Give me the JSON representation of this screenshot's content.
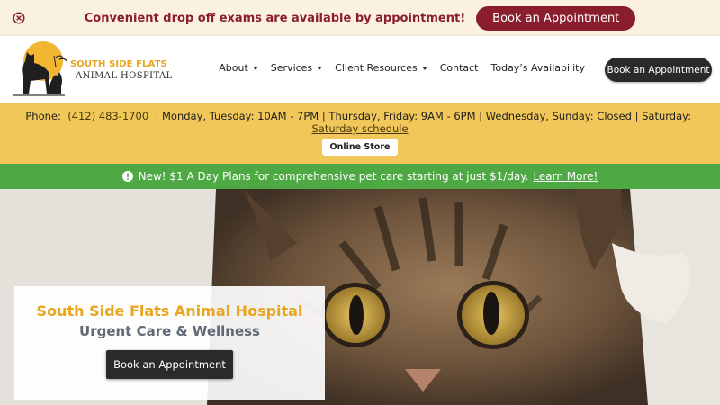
{
  "promo_bar": {
    "close_icon": "close-circle-icon",
    "message": "Convenient drop off exams are available by appointment!",
    "button_label": "Book an Appointment",
    "colors": {
      "background": "#fbf1e3",
      "accent": "#8b1e2d"
    }
  },
  "header": {
    "logo": {
      "line1": "SOUTH SIDE FLATS",
      "line2": "ANIMAL HOSPITAL",
      "icon": "dog-and-cat-logo-icon"
    },
    "nav": [
      {
        "label": "About",
        "has_dropdown": true
      },
      {
        "label": "Services",
        "has_dropdown": true
      },
      {
        "label": "Client Resources",
        "has_dropdown": true
      },
      {
        "label": "Contact",
        "has_dropdown": false
      },
      {
        "label": "Today’s Availability",
        "has_dropdown": false
      }
    ],
    "cta_label": "Book an Appointment"
  },
  "info_bar": {
    "phone_label": "Phone:",
    "phone": "(412) 483-1700",
    "hours": "| Monday, Tuesday: 10AM - 7PM | Thursday, Friday: 9AM - 6PM | Wednesday, Sunday: Closed | Saturday:",
    "saturday_link": "Saturday schedule",
    "store_button": "Online Store",
    "background": "#f1c75a"
  },
  "notice_bar": {
    "icon": "info-circle-icon",
    "message": "New! $1 A Day Plans for comprehensive pet care starting at just $1/day.",
    "link": "Learn More!",
    "background": "#4ea944"
  },
  "hero": {
    "image": "tabby-cat-photo",
    "title": "South Side Flats Animal Hospital",
    "subtitle": "Urgent Care & Wellness",
    "button_label": "Book an Appointment"
  }
}
